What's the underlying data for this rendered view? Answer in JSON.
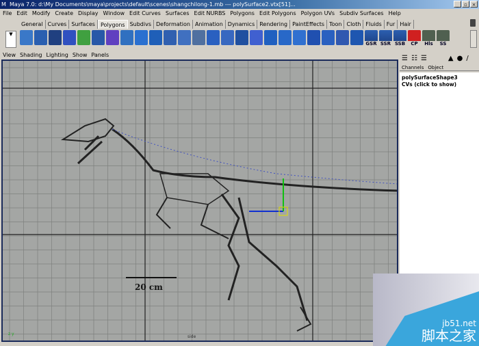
{
  "window": {
    "title": "Maya 7.0: d:\\My Documents\\maya\\projects\\default\\scenes\\shangchilong-1.mb  ---  polySurface2.vtx[51]...",
    "buttons": [
      "_",
      "▫",
      "×"
    ]
  },
  "menu": [
    "File",
    "Edit",
    "Modify",
    "Create",
    "Display",
    "Window",
    "Edit Curves",
    "Surfaces",
    "Edit NURBS",
    "Polygons",
    "Edit Polygons",
    "Polygon UVs",
    "Subdiv Surfaces",
    "Help"
  ],
  "shelf_tabs": [
    "General",
    "Curves",
    "Surfaces",
    "Polygons",
    "Subdivs",
    "Deformation",
    "Animation",
    "Dynamics",
    "Rendering",
    "PaintEffects",
    "Toon",
    "Cloth",
    "Fluids",
    "Fur",
    "Hair"
  ],
  "active_tab": "Polygons",
  "shelf_text_icons": [
    "GSR",
    "SSR",
    "SSB",
    "CP",
    "Hls",
    "SS"
  ],
  "view_menu": [
    "View",
    "Shading",
    "Lighting",
    "Show",
    "Panels"
  ],
  "viewport": {
    "camera_label": "side",
    "scale_label": "20 cm",
    "axis_label": "z y"
  },
  "channel_box": {
    "tabs": [
      "Channels",
      "Object"
    ],
    "object_name": "polySurfaceShape3",
    "cvs_label": "CVs (click to show)"
  },
  "watermark": {
    "url": "jb51.net",
    "name": "脚本之家"
  }
}
